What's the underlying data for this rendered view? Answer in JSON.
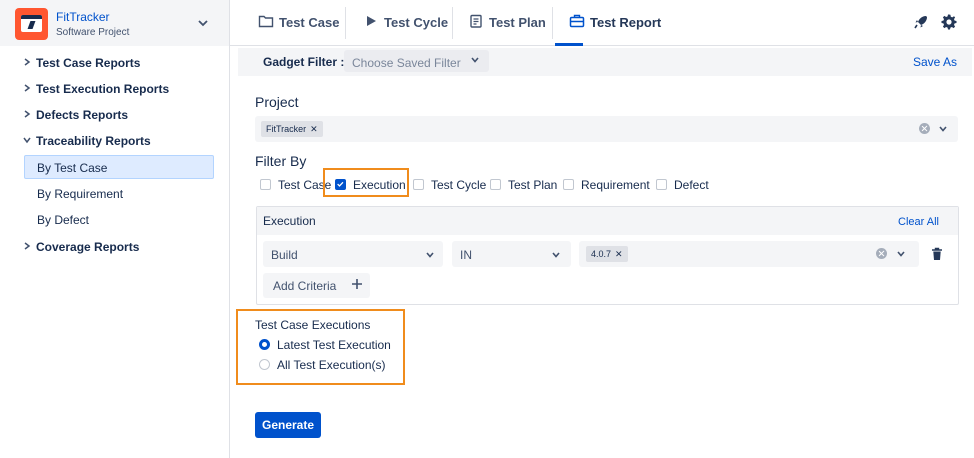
{
  "colors": {
    "accent": "#0052cc",
    "highlight": "#f08c1c",
    "project_logo": "#ff5630"
  },
  "project": {
    "name": "FitTracker",
    "type": "Software Project",
    "logo_icon": "desktop-bolt-icon"
  },
  "sidebar": {
    "items": [
      {
        "label": "Test Case Reports",
        "expanded": false
      },
      {
        "label": "Test Execution Reports",
        "expanded": false
      },
      {
        "label": "Defects Reports",
        "expanded": false
      },
      {
        "label": "Traceability Reports",
        "expanded": true
      },
      {
        "label": "Coverage Reports",
        "expanded": false
      }
    ],
    "subitems": [
      {
        "label": "By Test Case",
        "active": true
      },
      {
        "label": "By Requirement",
        "active": false
      },
      {
        "label": "By Defect",
        "active": false
      }
    ]
  },
  "tabs": [
    {
      "label": "Test Case",
      "icon": "folder-icon"
    },
    {
      "label": "Test Cycle",
      "icon": "play-icon"
    },
    {
      "label": "Test Plan",
      "icon": "clipboard-icon"
    },
    {
      "label": "Test Report",
      "icon": "briefcase-icon",
      "active": true
    }
  ],
  "toolbar": {
    "notify_icon": "rocket-icon",
    "settings_icon": "gear-icon"
  },
  "gadget": {
    "label": "Gadget Filter :",
    "placeholder": "Choose Saved Filter",
    "save_as": "Save As"
  },
  "project_field": {
    "label": "Project",
    "chip": "FitTracker"
  },
  "filter_by": {
    "label": "Filter By",
    "options": [
      {
        "label": "Test Case",
        "checked": false
      },
      {
        "label": "Execution",
        "checked": true
      },
      {
        "label": "Test Cycle",
        "checked": false
      },
      {
        "label": "Test Plan",
        "checked": false
      },
      {
        "label": "Requirement",
        "checked": false
      },
      {
        "label": "Defect",
        "checked": false
      }
    ]
  },
  "execution": {
    "title": "Execution",
    "clear_all": "Clear All",
    "field": "Build",
    "operator": "IN",
    "value_chip": "4.0.7",
    "add_criteria": "Add Criteria"
  },
  "test_case_executions": {
    "title": "Test Case Executions",
    "options": [
      {
        "label": "Latest Test Execution",
        "selected": true
      },
      {
        "label": "All Test Execution(s)",
        "selected": false
      }
    ]
  },
  "generate_label": "Generate"
}
